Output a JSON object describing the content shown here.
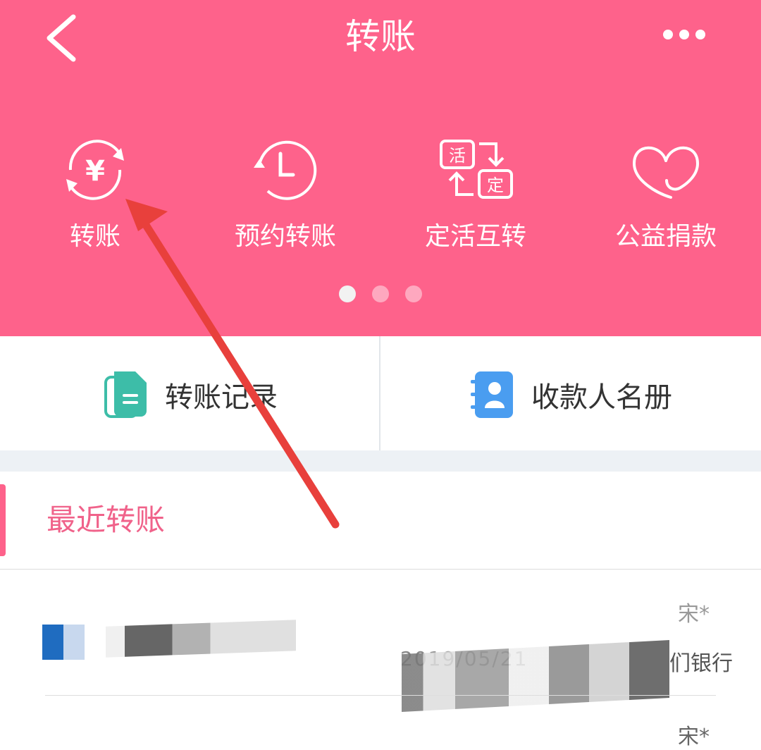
{
  "header": {
    "title": "转账",
    "features": [
      {
        "label": "转账",
        "icon": "yuan-transfer-icon"
      },
      {
        "label": "预约转账",
        "icon": "clock-icon"
      },
      {
        "label": "定活互转",
        "icon": "huo-ding-swap-icon",
        "icon_text": [
          "活",
          "定"
        ]
      },
      {
        "label": "公益捐款",
        "icon": "heart-icon"
      }
    ],
    "pager": {
      "count": 3,
      "active": 0
    }
  },
  "quick": {
    "records_label": "转账记录",
    "payees_label": "收款人名册"
  },
  "recent": {
    "title": "最近转账",
    "rows": [
      {
        "name_partial": "宋*",
        "bank_partial": "们银行",
        "date_partial": "2019/05/21"
      },
      {
        "name_partial": "宋*"
      }
    ]
  },
  "colors": {
    "brand": "#fe628b",
    "records_icon": "#3dbda8",
    "payees_icon": "#4a9df0"
  }
}
